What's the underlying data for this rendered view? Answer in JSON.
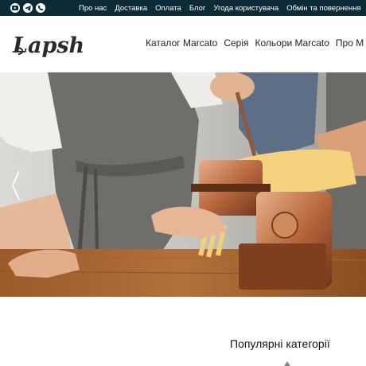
{
  "topbar": {
    "socials": [
      {
        "icon": "youtube-icon"
      },
      {
        "icon": "telegram-icon"
      },
      {
        "icon": "viber-icon"
      }
    ],
    "links": [
      "Про нас",
      "Доставка",
      "Оплата",
      "Блог",
      "Угода користувача",
      "Обмін та повернення"
    ]
  },
  "header": {
    "logo_text": "Lapsha",
    "nav": [
      "Каталог Marcato",
      "Серія",
      "Кольори Marcato",
      "Про М"
    ]
  },
  "hero": {
    "image": "hands cranking a copper pasta machine with fresh pasta on a wooden table"
  },
  "sections": {
    "popular_title": "Популярні категорії"
  },
  "colors": {
    "topbar_bg": "#0d2b36",
    "text": "#222222"
  }
}
